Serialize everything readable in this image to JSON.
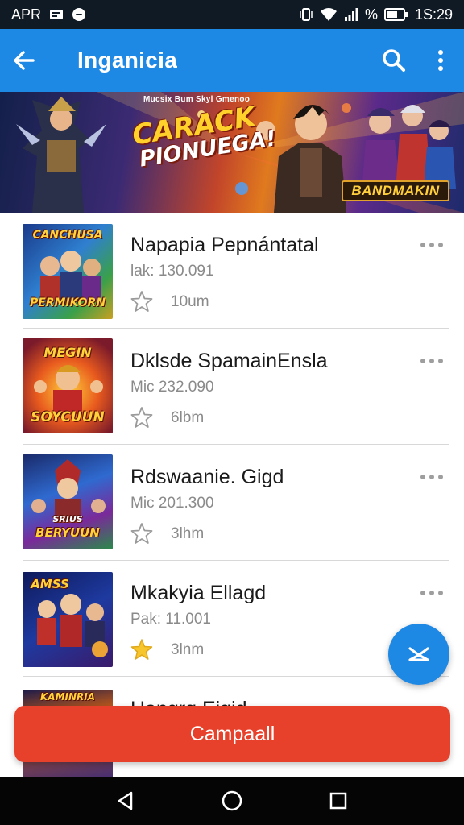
{
  "status_bar": {
    "carrier": "APR",
    "time": "1S:29",
    "battery_label": "%",
    "icons": [
      "message-icon",
      "chat-bubble-icon",
      "vibrate-icon",
      "wifi-icon",
      "signal-icon",
      "battery-icon"
    ]
  },
  "app_bar": {
    "title": "Inganicia",
    "back_icon": "arrow-left-icon",
    "search_icon": "search-icon",
    "menu_icon": "more-vert-icon",
    "color": "#1e88e5"
  },
  "banner": {
    "small_text": "Mucsix Bum Skyl Gmenoo",
    "headline_line1": "CARACK",
    "headline_line2": "PIONUEGA!",
    "brand": "BANDMAKIN"
  },
  "list": {
    "items": [
      {
        "name": "Napapia Pepnántatal",
        "meta": "lak: 130.091",
        "rating": "10um",
        "star_filled": false,
        "thumb_top": "CANCHUSA",
        "thumb_bottom": "PERMIKORN"
      },
      {
        "name": "Dklsde SpamainEnsla",
        "meta": "Mic 232.090",
        "rating": "6lbm",
        "star_filled": false,
        "thumb_top": "MEGIN",
        "thumb_bottom": "SOYCUUN"
      },
      {
        "name": "Rdswaanie. Gigd",
        "meta": "Mic 201.300",
        "rating": "3lhm",
        "star_filled": false,
        "thumb_top": "SRIUS",
        "thumb_bottom": "BERYUUN"
      },
      {
        "name": "Mkakyia Ellagd",
        "meta": "Pak: 11.001",
        "rating": "3lnm",
        "star_filled": true,
        "thumb_top": "AMSS",
        "thumb_bottom": ""
      },
      {
        "name": "Hangrg Eigid",
        "meta": "",
        "rating": "",
        "star_filled": false,
        "thumb_top": "KAMINRIA",
        "thumb_bottom": ""
      }
    ]
  },
  "fab": {
    "icon": "dismiss-icon",
    "color": "#1e88e5"
  },
  "cta": {
    "label": "Campaall",
    "color": "#e8412b"
  },
  "nav_bar": {
    "icons": [
      "back-triangle-icon",
      "home-circle-icon",
      "recents-square-icon"
    ]
  }
}
